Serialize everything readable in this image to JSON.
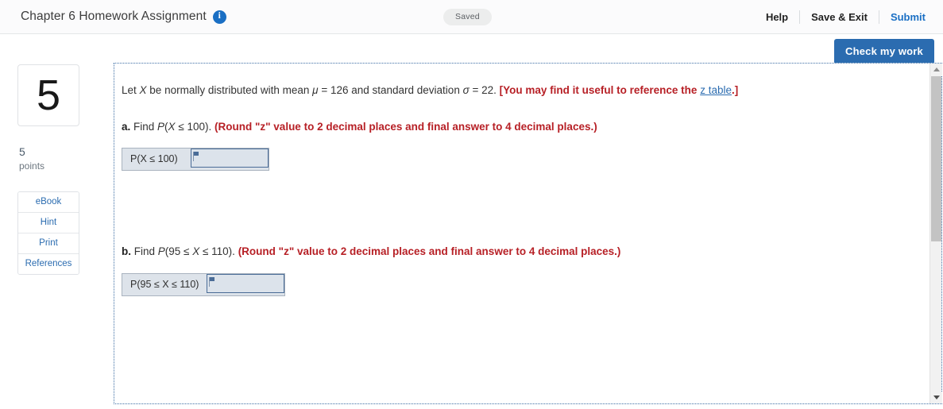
{
  "header": {
    "title": "Chapter 6 Homework Assignment",
    "info_icon": "info-icon",
    "saved_badge": "Saved",
    "help_label": "Help",
    "save_exit_label": "Save & Exit",
    "submit_label": "Submit"
  },
  "toolbar": {
    "check_work_label": "Check my work"
  },
  "sidebar": {
    "question_number": "5",
    "points_value": "5",
    "points_label": "points",
    "tools": [
      {
        "label": "eBook"
      },
      {
        "label": "Hint"
      },
      {
        "label": "Print"
      },
      {
        "label": "References"
      }
    ]
  },
  "question": {
    "stem_part1": "Let ",
    "stem_var": "X",
    "stem_part2": " be normally distributed with mean ",
    "stem_mu": "μ",
    "stem_mu_eq": " = 126 and standard deviation ",
    "stem_sigma": "σ",
    "stem_sigma_eq": " = 22. ",
    "note_open": "[You may find it useful to reference the ",
    "note_link": "z table",
    "note_close": ".]",
    "parts": [
      {
        "label": "a.",
        "prompt_pre": " Find ",
        "prompt_p": "P",
        "prompt_expr": "(X ≤ 100).",
        "prompt_expr_var": "X",
        "prompt_expr_rest": " ≤ 100).",
        "instruction": "(Round \"z\" value to 2 decimal places and final answer to 4 decimal places.)",
        "answer_label": "P(X ≤ 100)",
        "answer_value": "",
        "answer_placeholder": ""
      },
      {
        "label": "b.",
        "prompt_pre": " Find ",
        "prompt_p": "P",
        "prompt_expr": "(95 ≤ X ≤ 110).",
        "prompt_expr_var": "X",
        "prompt_expr_rest": " ≤ 110).",
        "instruction": "(Round \"z\" value to 2 decimal places and final answer to 4 decimal places.)",
        "answer_label": "P(95 ≤ X ≤ 110)",
        "answer_value": "",
        "answer_placeholder": ""
      }
    ]
  },
  "scrollbar": {
    "up_icon": "chevron-up-icon",
    "down_icon": "chevron-down-icon"
  },
  "colors": {
    "accent_blue": "#2b6cb0",
    "link_blue": "#2b6cb0",
    "alert_red": "#b72026",
    "panel_border": "#3f6fa5",
    "input_fill": "#dce3ea"
  }
}
